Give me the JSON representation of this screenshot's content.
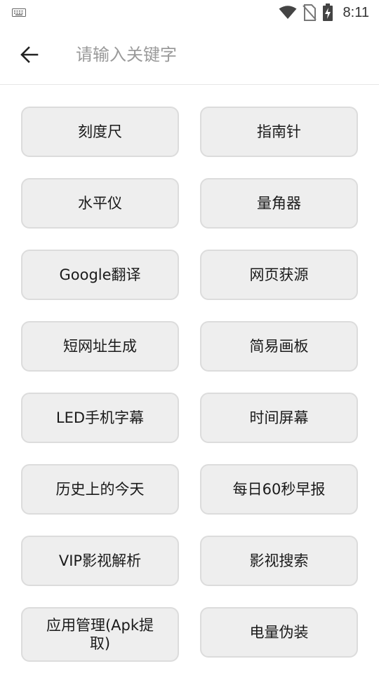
{
  "status_bar": {
    "time": "8:11",
    "icons": [
      "keyboard-icon",
      "wifi-icon",
      "no-sim-icon",
      "battery-charging-icon"
    ]
  },
  "header": {
    "back_icon": "arrow-left-icon",
    "search_placeholder": "请输入关键字",
    "search_value": ""
  },
  "tools": [
    {
      "label": "刻度尺"
    },
    {
      "label": "指南针"
    },
    {
      "label": "水平仪"
    },
    {
      "label": "量角器"
    },
    {
      "label": "Google翻译"
    },
    {
      "label": "网页获源"
    },
    {
      "label": "短网址生成"
    },
    {
      "label": "简易画板"
    },
    {
      "label": "LED手机字幕"
    },
    {
      "label": "时间屏幕"
    },
    {
      "label": "历史上的今天"
    },
    {
      "label": "每日60秒早报"
    },
    {
      "label": "VIP影视解析"
    },
    {
      "label": "影视搜索"
    },
    {
      "label": "应用管理(Apk提取)"
    },
    {
      "label": "电量伪装"
    }
  ]
}
